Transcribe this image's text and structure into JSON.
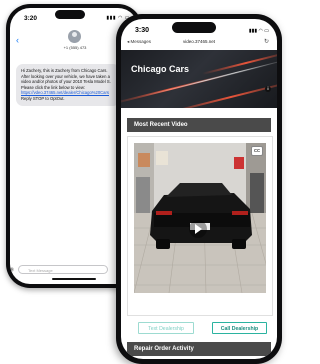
{
  "back_phone": {
    "status_time": "3:20",
    "contact_name": "+1 (555) 473",
    "sms_text_before_link": "Hi Zachery, this is Zachery from Chicago Cars. After looking over your vehicle, we have taken a video and/or photos of your 2010 Tesla Model S. Please click the link below to view: ",
    "sms_link": "https://vdeo.37465.net/dealer/Chicago%20Cars",
    "sms_text_after_link": " Reply STOP to OptOut.",
    "message_placeholder": "Text Message"
  },
  "front_phone": {
    "status_time": "3:30",
    "back_label": "◂ Messages",
    "url": "video.37465.net",
    "hero_title": "Chicago Cars",
    "section_recent_video": "Most Recent Video",
    "cc_label": "CC",
    "text_dealership_label": "Text Dealership",
    "call_dealership_label": "Call Dealership",
    "section_repair_order": "Repair Order Activity"
  },
  "colors": {
    "accent_teal": "#2bb3a0",
    "section_header_bg": "#4a4a4a",
    "imessage_link": "#1a5bd8"
  },
  "icons": [
    "signal-icon",
    "wifi-icon",
    "battery-icon",
    "back-chevron-icon",
    "contact-avatar-icon",
    "camera-icon",
    "refresh-icon",
    "info-icon",
    "cc-icon",
    "play-icon"
  ]
}
